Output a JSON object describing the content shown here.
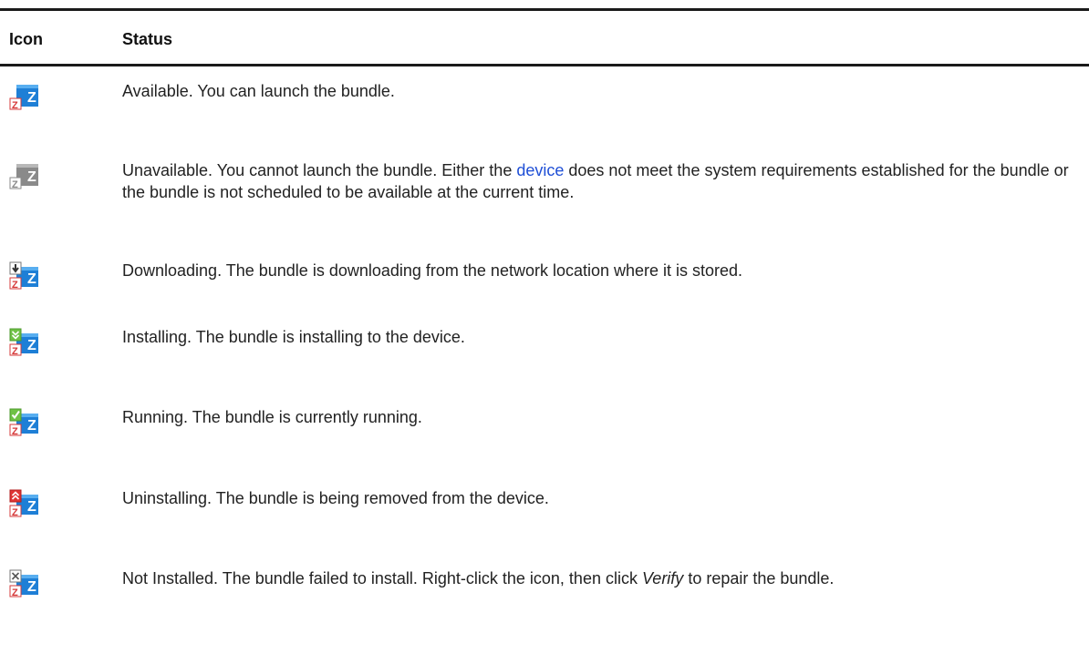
{
  "table": {
    "headers": {
      "icon": "Icon",
      "status": "Status"
    },
    "rows": [
      {
        "icon": "bundle-available-icon",
        "text": "Available. You can launch the bundle."
      },
      {
        "icon": "bundle-unavailable-icon",
        "text_before_link": "Unavailable. You cannot launch the bundle. Either the ",
        "link": "device",
        "text_after_link": " does not meet the system requirements established for the bundle or the bundle is not scheduled to be available at the current time."
      },
      {
        "icon": "bundle-downloading-icon",
        "text": "Downloading. The bundle is downloading from the network location where it is stored."
      },
      {
        "icon": "bundle-installing-icon",
        "text": "Installing. The bundle is installing to the device."
      },
      {
        "icon": "bundle-running-icon",
        "text": "Running. The bundle is currently running."
      },
      {
        "icon": "bundle-uninstalling-icon",
        "text": "Uninstalling. The bundle is being removed from the device."
      },
      {
        "icon": "bundle-not-installed-icon",
        "text_before_emphasis": "Not Installed. The bundle failed to install. Right-click the icon, then click ",
        "emphasis": "Verify",
        "text_after_emphasis": " to repair the bundle."
      }
    ]
  },
  "colors": {
    "rule": "#1a1a1a",
    "link": "#1f4fd6",
    "zen_blue": "#1e7fd6",
    "zen_gray": "#8a8a8a",
    "zen_red": "#d63a3a"
  }
}
